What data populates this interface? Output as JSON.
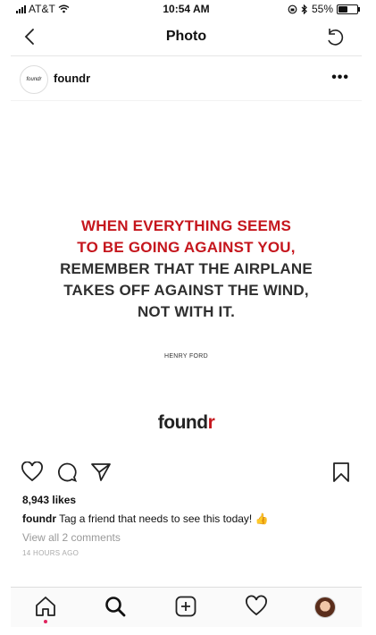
{
  "status_bar": {
    "carrier": "AT&T",
    "time": "10:54 AM",
    "battery": "55%",
    "battery_level": 0.55
  },
  "nav": {
    "title": "Photo"
  },
  "post": {
    "avatar_text": "foundr",
    "username": "foundr",
    "more_label": "•••",
    "quote_red": [
      "WHEN EVERYTHING SEEMS",
      "TO BE GOING AGAINST YOU,"
    ],
    "quote_dark": [
      "REMEMBER THAT THE AIRPLANE",
      "TAKES OFF AGAINST THE WIND,",
      "NOT WITH IT."
    ],
    "author": "HENRY FORD",
    "brand_main": "found",
    "brand_accent": "r",
    "likes": "8,943 likes",
    "caption_user": "foundr",
    "caption_text": " Tag a friend that needs to see this today! 👍",
    "view_comments": "View all 2 comments",
    "time_ago": "14 HOURS AGO"
  },
  "colors": {
    "accent_red": "#c5161d",
    "notification_dot": "#e0245e"
  }
}
